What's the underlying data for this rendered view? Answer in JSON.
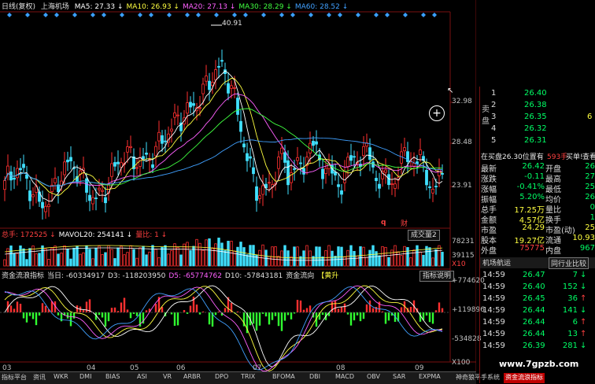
{
  "header": {
    "title": "日线(复权)",
    "stock": "上海机场",
    "ma": [
      {
        "label": "MA5: 27.33",
        "color": "#ffffff"
      },
      {
        "label": "MA10: 26.93",
        "color": "#ffff40"
      },
      {
        "label": "MA20: 27.13",
        "color": "#ff60ff"
      },
      {
        "label": "MA30: 28.29",
        "color": "#40ff40"
      },
      {
        "label": "MA60: 28.52",
        "color": "#40a0ff"
      }
    ]
  },
  "price_axis": [
    "32.98",
    "28.48",
    "23.91"
  ],
  "peak_label": "40.91",
  "fundamentals_marks": [
    "q",
    "财"
  ],
  "volume": {
    "legend": [
      {
        "label": "总手: 172525",
        "color": "#ff4040"
      },
      {
        "label": "MAVOL20: 254141",
        "color": "#ffffff"
      },
      {
        "label": "量比: 1",
        "color": "#ff4040"
      }
    ],
    "button": "成交量2",
    "axis": [
      "78231",
      "39115",
      "X10"
    ]
  },
  "flow": {
    "legend": [
      {
        "label": "资金流浪指标",
        "color": "#e0e0e0"
      },
      {
        "label": "当日: -60334917",
        "color": "#e0e0e0"
      },
      {
        "label": "D3: -118203950",
        "color": "#e0e0e0"
      },
      {
        "label": "D5: -65774762",
        "color": "#ff60ff"
      },
      {
        "label": "D10: -57843181",
        "color": "#e0e0e0"
      },
      {
        "label": "资金流向",
        "color": "#e0e0e0"
      },
      {
        "label": "【黄升",
        "color": "#ffff40"
      }
    ],
    "button": "指标说明",
    "axis": [
      "+774620",
      "+119896",
      "-534828",
      "X100"
    ]
  },
  "time_axis": [
    "03",
    "04",
    "05",
    "06",
    "07",
    "08",
    "09"
  ],
  "tabs": [
    "指标平台",
    "资讯",
    "WKR",
    "DMI",
    "BIAS",
    "ASI",
    "VR",
    "ARBR",
    "DPO",
    "TRIX",
    "BFOMA",
    "DBI",
    "MACD",
    "OBV",
    "SAR",
    "EXPMA",
    "神奇狼平手系统",
    "资金流浪指标"
  ],
  "active_tab": "资金流浪指标",
  "order_book": {
    "sell_label": "卖盘",
    "buy_label": "买盘",
    "rows": [
      {
        "n": "1",
        "price": "26.40"
      },
      {
        "n": "2",
        "price": "26.38"
      },
      {
        "n": "3",
        "price": "26.35",
        "vol": "6"
      },
      {
        "n": "4",
        "price": "26.32"
      },
      {
        "n": "5",
        "price": "26.31"
      }
    ],
    "note": "在买盘26.30位置有",
    "note_vol": "593手",
    "note_link": "买单!",
    "note_link2": "查看详"
  },
  "quote": [
    {
      "k": "最新",
      "v": "26.42",
      "k2": "开盘",
      "v2": "26"
    },
    {
      "k": "涨跌",
      "v": "-0.11",
      "k2": "最高",
      "v2": "27"
    },
    {
      "k": "涨幅",
      "v": "-0.41%",
      "k2": "最低",
      "v2": "25"
    },
    {
      "k": "振幅",
      "v": "5.20%",
      "k2": "均价",
      "v2": "26"
    },
    {
      "k": "总手",
      "v": "17.25万",
      "k2": "量比",
      "v2": "0"
    },
    {
      "k": "金额",
      "v": "4.57亿",
      "k2": "换手",
      "v2": "1"
    },
    {
      "k": "市盈",
      "v": "24.29",
      "k2": "市盈(动)",
      "v2": "25"
    },
    {
      "k": "股本",
      "v": "19.27亿",
      "k2": "流通",
      "v2": "10.93"
    },
    {
      "k": "外盘",
      "v": "75775",
      "k2": "内盘",
      "v2": "967"
    }
  ],
  "tabs2": {
    "left": "机场航运",
    "right": "同行业比较"
  },
  "ticks": [
    {
      "t": "14:59",
      "p": "26.47",
      "v": "7",
      "dir": "down"
    },
    {
      "t": "14:59",
      "p": "26.40",
      "v": "152",
      "dir": "down"
    },
    {
      "t": "14:59",
      "p": "26.45",
      "v": "36",
      "dir": "up"
    },
    {
      "t": "14:59",
      "p": "26.44",
      "v": "141",
      "dir": "down"
    },
    {
      "t": "14:59",
      "p": "26.44",
      "v": "6",
      "dir": "up"
    },
    {
      "t": "14:59",
      "p": "26.44",
      "v": "13",
      "dir": "up"
    },
    {
      "t": "14:59",
      "p": "26.39",
      "v": "281",
      "dir": "down"
    }
  ],
  "watermark": "www.7gpzb.com"
}
